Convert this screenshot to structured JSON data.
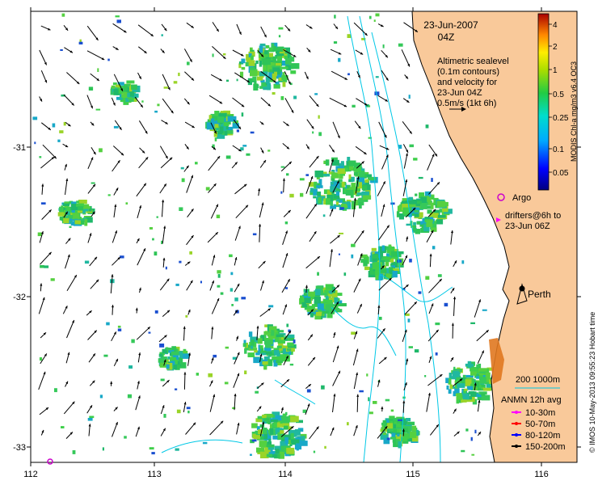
{
  "map": {
    "date": "23-Jun-2007",
    "time": "04Z",
    "description_lines": [
      "Altimetric sealevel",
      "(0.1m contours)",
      "and velocity for",
      "23-Jun 04Z",
      "0.5m/s (1kt 6h)"
    ],
    "argo_label": "Argo",
    "drifters_lines": [
      "drifters@6h to",
      "23-Jun 06Z"
    ],
    "city_label": "Perth",
    "scale_label": "200  1000m",
    "anmn_title": "ANMN 12h avg",
    "anmn_items": [
      {
        "label": "10-30m",
        "color": "#ff00ff"
      },
      {
        "label": "50-70m",
        "color": "#ff0000"
      },
      {
        "label": "80-120m",
        "color": "#0000ff"
      },
      {
        "label": "150-200m",
        "color": "#000000"
      }
    ],
    "x_ticks": [
      "112",
      "113",
      "114",
      "115",
      "116"
    ],
    "y_ticks": [
      "-31",
      "-32",
      "-33"
    ],
    "colorbar": {
      "title": "MODIS Chl-a mg/m3 v6.4 OC3",
      "ticks": [
        "4",
        "2",
        "1",
        "0.5",
        "0.25",
        "0.1",
        "0.05"
      ]
    },
    "credit": "© IMOS 10-May-2013 09:55:23 Hobart time",
    "colors": {
      "land": "#f9c99a",
      "coast_contour": "#00c8e6",
      "argo": "#cc00cc"
    }
  }
}
